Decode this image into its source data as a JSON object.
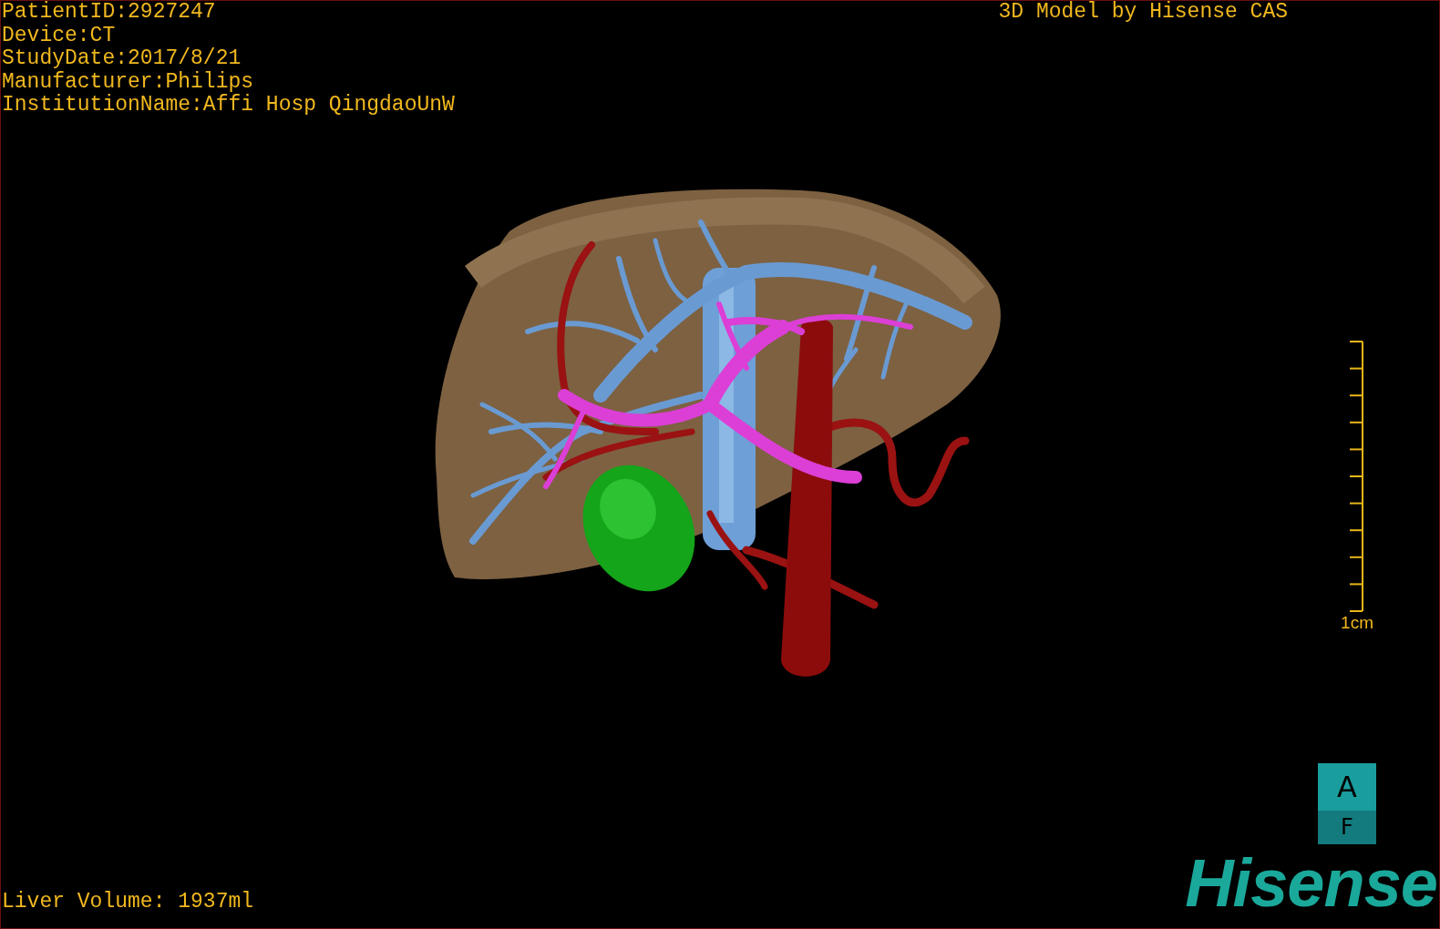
{
  "header": {
    "info_lines": [
      "PatientID:2927247",
      "Device:CT",
      "StudyDate:2017/8/21",
      "Manufacturer:Philips",
      "InstitutionName:Affi Hosp QingdaoUnW"
    ],
    "title": "3D Model by Hisense CAS"
  },
  "scale": {
    "label": "1cm"
  },
  "orientation": {
    "faces": [
      "A",
      "F"
    ]
  },
  "footer": {
    "liver_volume": "Liver Volume: 1937ml",
    "logo": "Hisense"
  }
}
